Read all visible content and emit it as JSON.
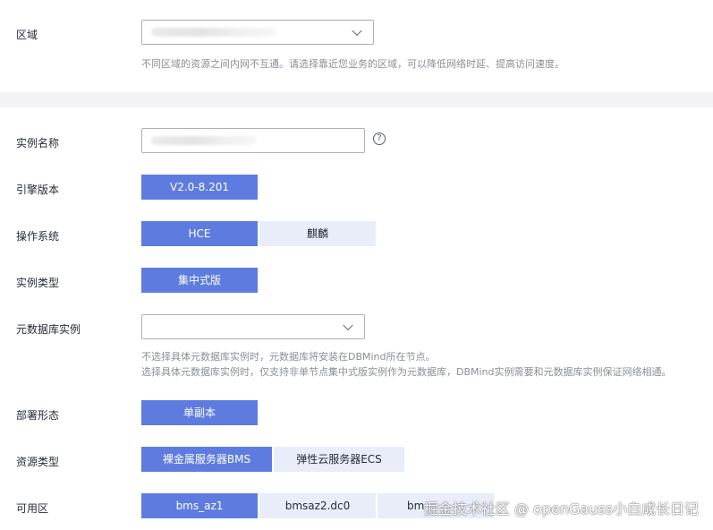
{
  "region": {
    "label": "区域",
    "hint": "不同区域的资源之间内网不互通。请选择靠近您业务的区域，可以降低网络时延、提高访问速度。"
  },
  "instance_name": {
    "label": "实例名称",
    "help_icon": "question-circle-icon"
  },
  "engine_version": {
    "label": "引擎版本",
    "options": [
      "V2.0-8.201"
    ],
    "selected": "V2.0-8.201"
  },
  "os": {
    "label": "操作系统",
    "options": [
      "HCE",
      "麒麟"
    ],
    "selected": "HCE"
  },
  "instance_type": {
    "label": "实例类型",
    "options": [
      "集中式版"
    ],
    "selected": "集中式版"
  },
  "metadb": {
    "label": "元数据库实例",
    "hint_line1": "不选择具体元数据库实例时，元数据库将安装在DBMind所在节点。",
    "hint_line2": "选择具体元数据库实例时，仅支持非单节点集中式版实例作为元数据库，DBMind实例需要和元数据库实例保证网络相通。"
  },
  "deploy": {
    "label": "部署形态",
    "options": [
      "单副本"
    ],
    "selected": "单副本"
  },
  "resource_type": {
    "label": "资源类型",
    "options": [
      "裸金属服务器BMS",
      "弹性云服务器ECS"
    ],
    "selected": "裸金属服务器BMS"
  },
  "az": {
    "label": "可用区",
    "options": [
      "bms_az1",
      "bmsaz2.dc0",
      "bm"
    ],
    "selected": "bms_az1"
  },
  "watermark": "掘金技术社区 @ openGauss小白成长日记",
  "colors": {
    "accent": "#5e7ce0",
    "option_off": "#e9edfa",
    "hint": "#8a8e99",
    "section_gap": "#f3f3f5"
  }
}
